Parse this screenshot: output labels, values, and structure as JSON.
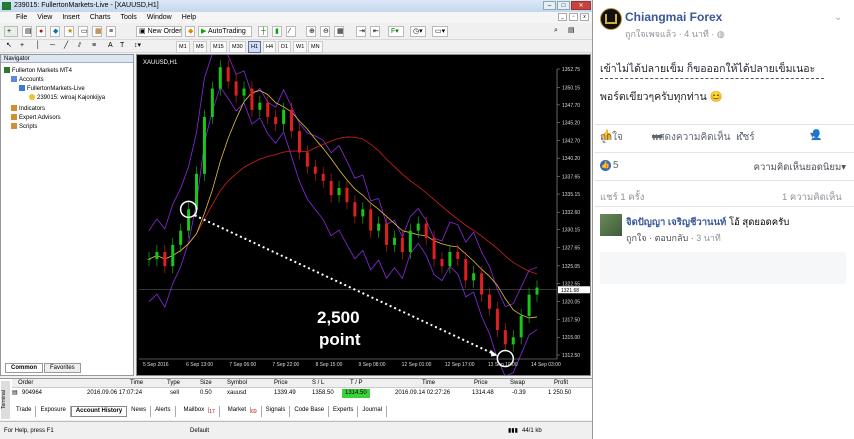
{
  "app": {
    "title": "239015: FullertonMarkets-Live - [XAUUSD,H1]",
    "menu": [
      "File",
      "View",
      "Insert",
      "Charts",
      "Tools",
      "Window",
      "Help"
    ],
    "toolbar": {
      "new_order": "New Order",
      "autotrading": "AutoTrading"
    },
    "timeframes": [
      "M1",
      "M5",
      "M15",
      "M30",
      "H1",
      "H4",
      "D1",
      "W1",
      "MN"
    ],
    "active_timeframe": "H1"
  },
  "navigator": {
    "title": "Navigator",
    "items": [
      "Fullerton Markets MT4",
      "Accounts",
      "FullertonMarkets-Live",
      "239015: wiroaj Kajonkijya",
      "Indicators",
      "Expert Advisors",
      "Scripts"
    ],
    "tabs": [
      "Common",
      "Favorites"
    ]
  },
  "chart_data": {
    "type": "line",
    "title": "XAUUSD,H1",
    "instrument": "XAUUSD",
    "timeframe": "H1",
    "x_labels": [
      "5 Sep 2016",
      "6 Sep 13:00",
      "7 Sep 06:00",
      "7 Sep 22:00",
      "8 Sep 15:00",
      "9 Sep 08:00",
      "12 Sep 01:00",
      "12 Sep 17:00",
      "13 Sep 10:00",
      "14 Sep 03:00"
    ],
    "y_ticks": [
      "1352.75",
      "1350.15",
      "1347.70",
      "1345.20",
      "1342.70",
      "1340.20",
      "1337.65",
      "1335.15",
      "1332.60",
      "1330.15",
      "1327.65",
      "1325.05",
      "1322.55",
      "1320.05",
      "1317.50",
      "1315.00",
      "1312.50"
    ],
    "ylim": [
      1312.5,
      1352.75
    ],
    "current_price": "1321.68",
    "annotation": {
      "line1": "2,500",
      "line2": "point"
    },
    "series": [
      {
        "values": [
          1326,
          1327,
          1325,
          1328,
          1330,
          1333,
          1338,
          1346,
          1350,
          1353,
          1351,
          1349,
          1350,
          1347,
          1348,
          1346,
          1345,
          1347,
          1344,
          1341,
          1339,
          1338,
          1337,
          1335,
          1336,
          1334,
          1332,
          1333,
          1330,
          1331,
          1328,
          1329,
          1327,
          1330,
          1331,
          1329,
          1326,
          1325,
          1327,
          1326,
          1323,
          1324,
          1321,
          1319,
          1316,
          1314,
          1315,
          1318,
          1321,
          1322
        ]
      }
    ]
  },
  "terminal": {
    "side_label": "Terminal",
    "headers": [
      "Order",
      "Time",
      "Type",
      "Size",
      "Symbol",
      "Price",
      "S / L",
      "T / P",
      "Time",
      "Price",
      "Swap",
      "Profit"
    ],
    "row": [
      "904964",
      "2016.09.06 17:07:24",
      "sell",
      "0.50",
      "xauusd",
      "1339.49",
      "1358.50",
      "1314.50",
      "2016.09.14 02:27:26",
      "1314.48",
      "-0.39",
      "1 250.50"
    ],
    "tabs": [
      "Trade",
      "Exposure",
      "Account History",
      "News",
      "Alerts",
      "Mailbox",
      "Market",
      "Signals",
      "Code Base",
      "Experts",
      "Journal"
    ],
    "active_tab": "Account History",
    "badges": {
      "Mailbox": "17",
      "Market": "69"
    }
  },
  "statusbar": {
    "help": "For Help, press F1",
    "profile": "Default",
    "traffic": "44/1 kb"
  },
  "fb": {
    "page_name": "Chiangmai Forex",
    "meta": "ถูกใจเพจแล้ว · 4 นาที · ",
    "post_line1": "เข้าไม่ได้ปลายเข็ม ก็ขอออกให้ได้ปลายเข็มเนอะ",
    "post_line2": "พอร์ตเขียวๆครับทุกท่าน 😊",
    "actions": {
      "like": "ถูกใจ",
      "comment": "แสดงความคิดเห็น",
      "share": "แชร์"
    },
    "reactions": "5",
    "sort": "ความคิดเห็นยอดนิยม",
    "shares": "แชร์ 1 ครั้ง",
    "comments_count": "1 ความคิดเห็น",
    "comment": {
      "name": "จิดปัญญา เจริญชีวานนท์",
      "text": "โอ้ สุดยอดครับ",
      "like": "ถูกใจ",
      "reply": "ตอบกลับ",
      "time": "3 นาที"
    }
  }
}
